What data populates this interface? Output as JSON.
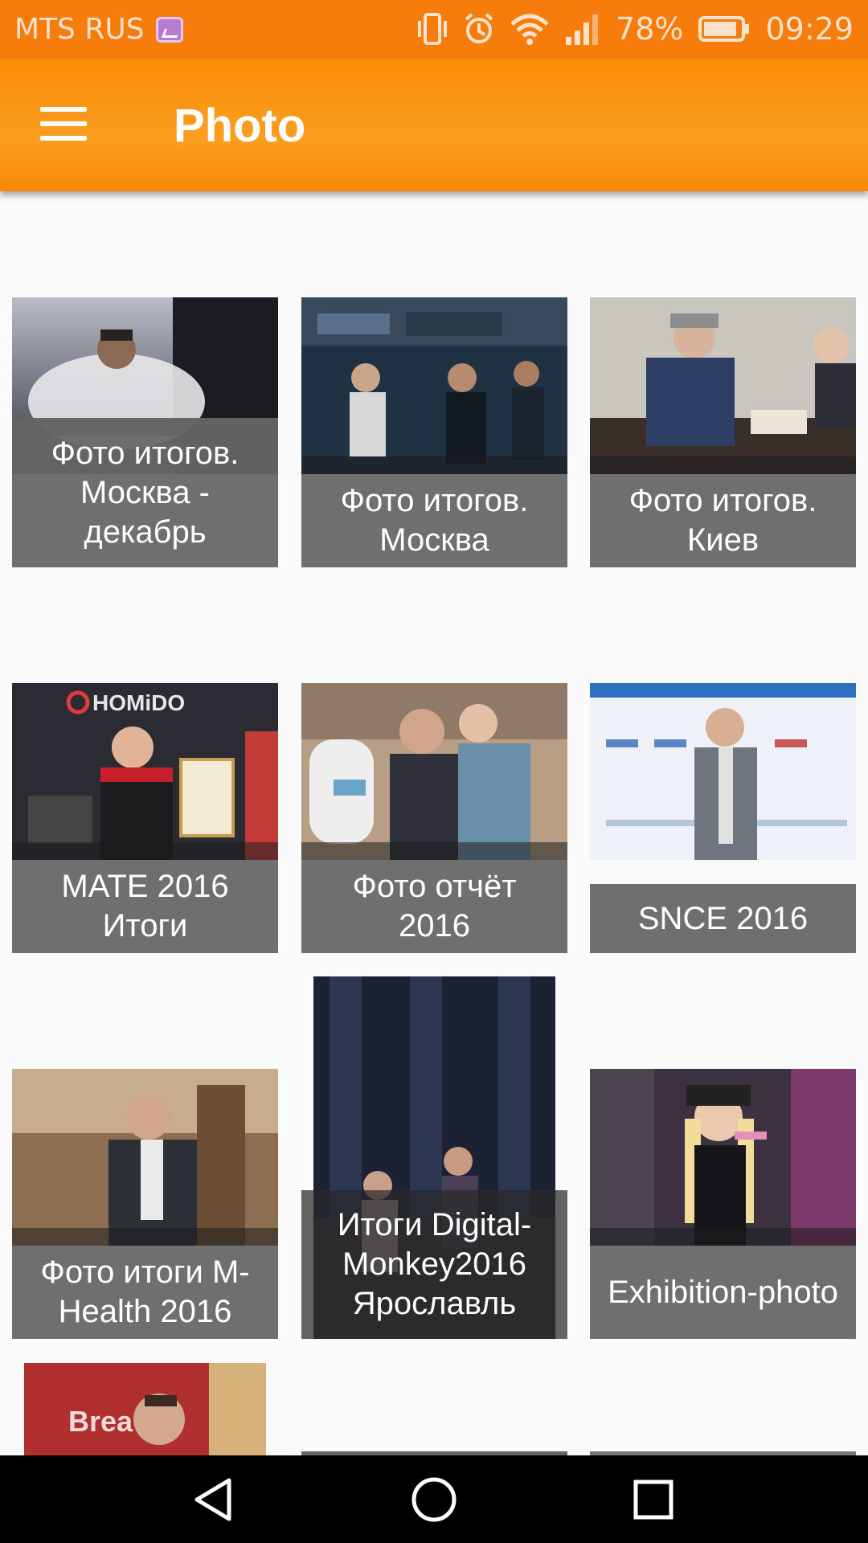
{
  "status_bar": {
    "carrier": "MTS RUS",
    "battery_percent": "78%",
    "time": "09:29"
  },
  "app_bar": {
    "title": "Photo"
  },
  "albums": [
    {
      "caption": "Фото итогов. Москва - декабрь"
    },
    {
      "caption": "Фото итогов. Москва"
    },
    {
      "caption": "Фото итогов. Киев"
    },
    {
      "caption": "MATE 2016 Итоги"
    },
    {
      "caption": "Фото отчёт 2016"
    },
    {
      "caption": "SNCE 2016"
    },
    {
      "caption": "Фото итоги M-Health 2016"
    },
    {
      "caption": "Итоги Digital-Monkey2016 Ярославль"
    },
    {
      "caption": "Exhibition-photo"
    },
    {
      "caption": ""
    }
  ],
  "colors": {
    "status_bar": "#f67c0c",
    "app_bar": "#fb9e20",
    "caption_bg": "#666666"
  }
}
